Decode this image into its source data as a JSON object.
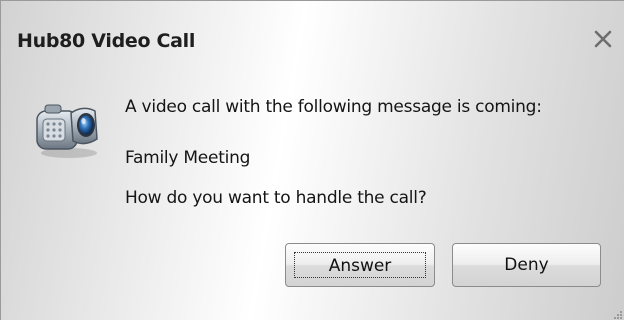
{
  "dialog": {
    "title": "Hub80 Video Call",
    "close_icon": "close-icon",
    "icon": "video-camera-icon",
    "message_intro": "A video call with the following message is coming:",
    "message_text": "Family Meeting",
    "question": "How do you want to handle the call?",
    "buttons": {
      "answer_label": "Answer",
      "deny_label": "Deny"
    }
  }
}
